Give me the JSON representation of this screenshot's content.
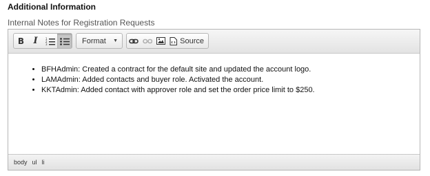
{
  "section": {
    "heading": "Additional Information"
  },
  "field": {
    "label": "Internal Notes for Registration Requests"
  },
  "toolbar": {
    "bold_label": "B",
    "italic_label": "I",
    "format_combo": {
      "selected": "Format"
    },
    "source_label": "Source"
  },
  "content": {
    "items": [
      "BFHAdmin: Created a contract for the default site and updated the account logo.",
      "LAMAdmin: Added contacts and buyer role. Activated the account.",
      "KKTAdmin: Added contact with approver role and set the order price limit to $250."
    ]
  },
  "statusbar": {
    "path": [
      "body",
      "ul",
      "li"
    ]
  }
}
